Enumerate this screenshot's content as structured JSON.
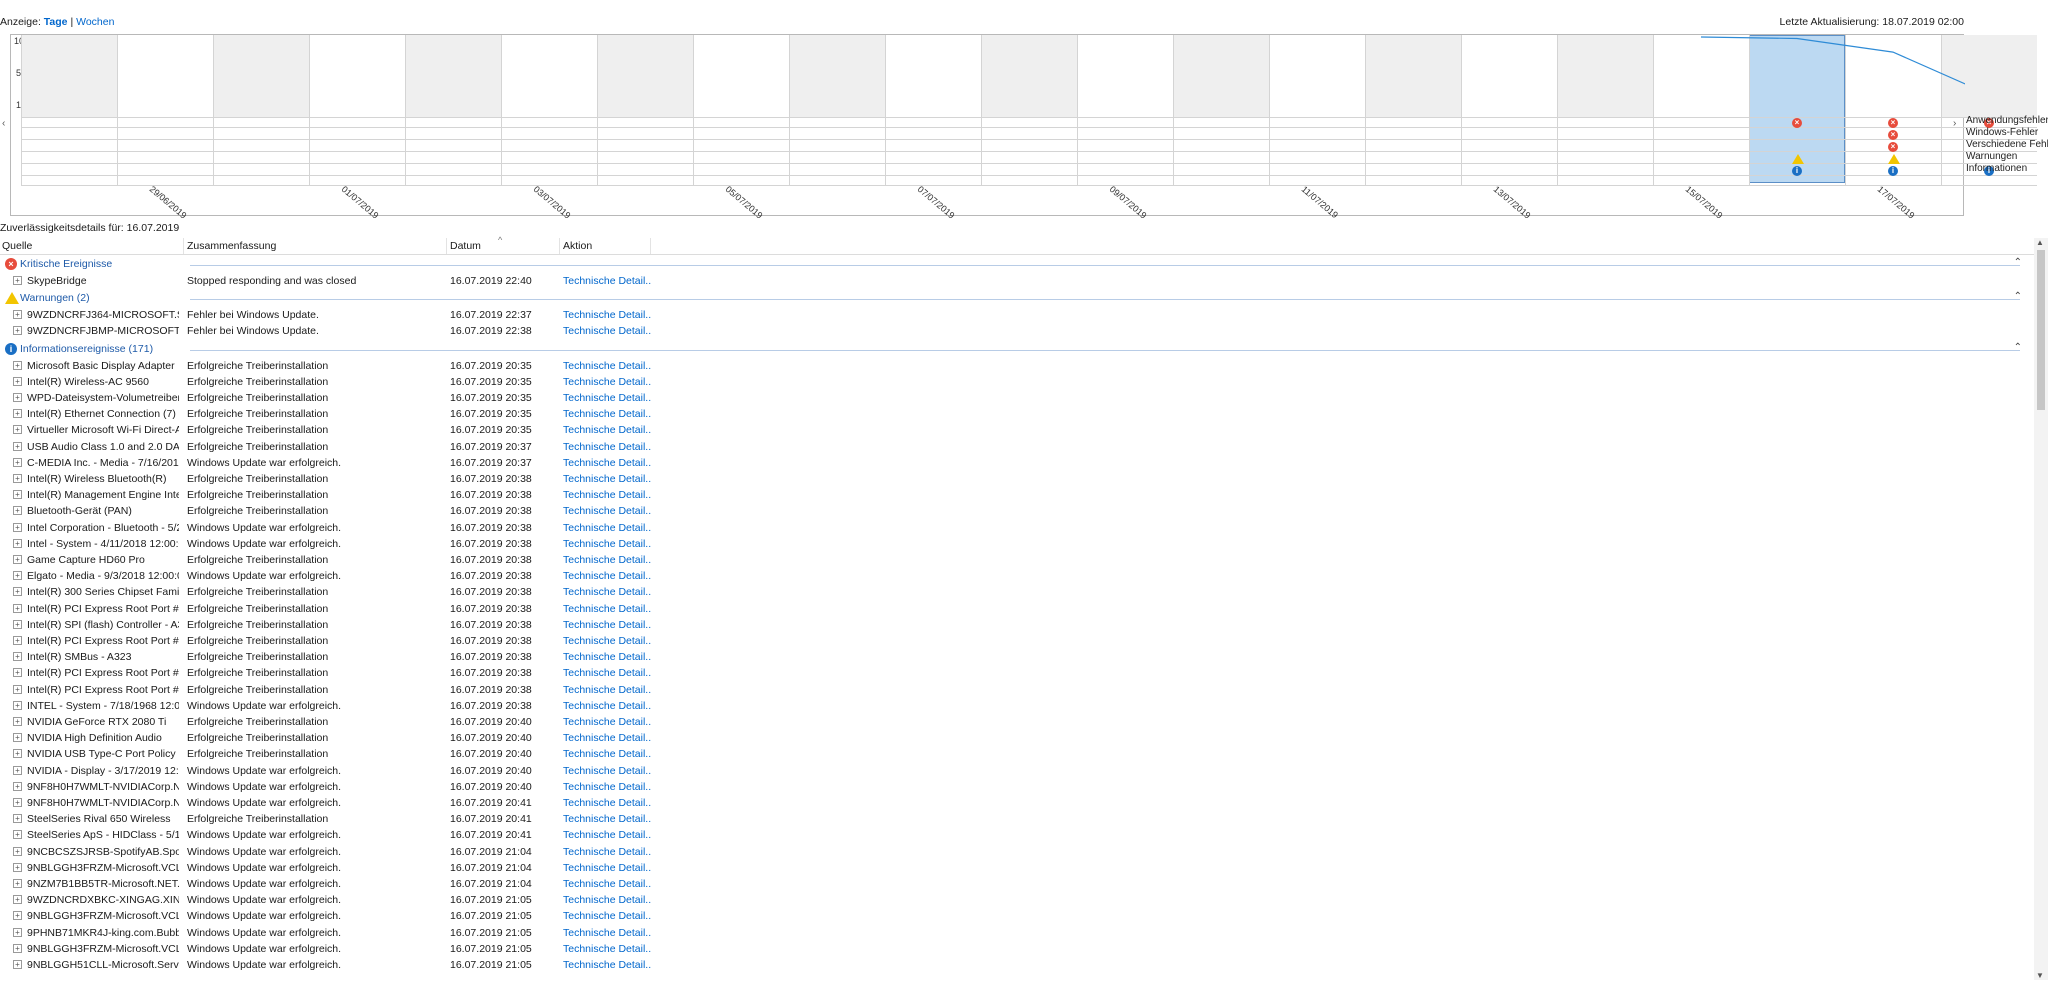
{
  "view": {
    "label": "Anzeige:",
    "days": "Tage",
    "separator": "|",
    "weeks": "Wochen"
  },
  "last_update": "Letzte Aktualisierung: 18.07.2019 02:00",
  "chart": {
    "y_ticks": [
      "10",
      "5",
      "1"
    ],
    "x_labels": [
      "29/06/2019",
      "01/07/2019",
      "03/07/2019",
      "05/07/2019",
      "07/07/2019",
      "09/07/2019",
      "11/07/2019",
      "13/07/2019",
      "15/07/2019",
      "17/07/2019"
    ],
    "row_labels": [
      "Anwendungsfehler",
      "Windows-Fehler",
      "Verschiedene Fehler",
      "Warnungen",
      "Informationen"
    ],
    "nav_left": "‹",
    "nav_right": "›"
  },
  "chart_data": {
    "type": "line",
    "title": "",
    "xlabel": "",
    "ylabel": "",
    "ylim": [
      1,
      10
    ],
    "x": [
      "28/06/2019",
      "29/06/2019",
      "30/06/2019",
      "01/07/2019",
      "02/07/2019",
      "03/07/2019",
      "04/07/2019",
      "05/07/2019",
      "06/07/2019",
      "07/07/2019",
      "08/07/2019",
      "09/07/2019",
      "10/07/2019",
      "11/07/2019",
      "12/07/2019",
      "13/07/2019",
      "14/07/2019",
      "15/07/2019",
      "16/07/2019",
      "17/07/2019",
      "18/07/2019"
    ],
    "series": [
      {
        "values": [
          null,
          null,
          null,
          null,
          null,
          null,
          null,
          null,
          null,
          null,
          null,
          null,
          null,
          null,
          null,
          null,
          null,
          10,
          9.8,
          8.0,
          2.4,
          2.2
        ]
      }
    ],
    "selected_day": "16/07/2019",
    "events": [
      {
        "day": "16/07/2019",
        "row": "Anwendungsfehler",
        "kind": "critical"
      },
      {
        "day": "16/07/2019",
        "row": "Warnungen",
        "kind": "warning"
      },
      {
        "day": "16/07/2019",
        "row": "Informationen",
        "kind": "info"
      },
      {
        "day": "17/07/2019",
        "row": "Anwendungsfehler",
        "kind": "critical"
      },
      {
        "day": "17/07/2019",
        "row": "Windows-Fehler",
        "kind": "critical"
      },
      {
        "day": "17/07/2019",
        "row": "Verschiedene Fehler",
        "kind": "critical"
      },
      {
        "day": "17/07/2019",
        "row": "Warnungen",
        "kind": "warning"
      },
      {
        "day": "17/07/2019",
        "row": "Informationen",
        "kind": "info"
      },
      {
        "day": "18/07/2019",
        "row": "Anwendungsfehler",
        "kind": "critical"
      },
      {
        "day": "18/07/2019",
        "row": "Informationen",
        "kind": "info"
      }
    ]
  },
  "details_title": "Zuverlässigkeitsdetails für: 16.07.2019",
  "table": {
    "headers": [
      "Quelle",
      "Zusammenfassung",
      "Datum",
      "Aktion"
    ],
    "sort_indicator": "^",
    "groups": [
      {
        "label": "Kritische Ereignisse",
        "icon": "critical-icon",
        "color": "#e74c3c",
        "rows": [
          [
            "SkypeBridge",
            "Stopped responding and was closed",
            "16.07.2019 22:40",
            "Technische Detail..."
          ]
        ]
      },
      {
        "label": "Warnungen (2)",
        "icon": "warning-icon",
        "color": "#f2c500",
        "rows": [
          [
            "9WZDNCRFJ364-MICROSOFT.SKY...",
            "Fehler bei Windows Update.",
            "16.07.2019 22:37",
            "Technische Detail..."
          ],
          [
            "9WZDNCRFJBMP-MICROSOFT.WI...",
            "Fehler bei Windows Update.",
            "16.07.2019 22:38",
            "Technische Detail..."
          ]
        ]
      },
      {
        "label": "Informationsereignisse (171)",
        "icon": "info-icon",
        "color": "#1a6fc4",
        "rows": [
          [
            "Microsoft Basic Display Adapter",
            "Erfolgreiche Treiberinstallation",
            "16.07.2019 20:35",
            "Technische Detail..."
          ],
          [
            "Intel(R) Wireless-AC 9560",
            "Erfolgreiche Treiberinstallation",
            "16.07.2019 20:35",
            "Technische Detail..."
          ],
          [
            "WPD-Dateisystem-Volumetreiber",
            "Erfolgreiche Treiberinstallation",
            "16.07.2019 20:35",
            "Technische Detail..."
          ],
          [
            "Intel(R) Ethernet Connection (7) I2...",
            "Erfolgreiche Treiberinstallation",
            "16.07.2019 20:35",
            "Technische Detail..."
          ],
          [
            "Virtueller Microsoft Wi-Fi Direct-A...",
            "Erfolgreiche Treiberinstallation",
            "16.07.2019 20:35",
            "Technische Detail..."
          ],
          [
            "USB Audio Class 1.0 and 2.0 DAC ...",
            "Erfolgreiche Treiberinstallation",
            "16.07.2019 20:37",
            "Technische Detail..."
          ],
          [
            "C-MEDIA Inc. - Media - 7/16/2018 ...",
            "Windows Update war erfolgreich.",
            "16.07.2019 20:37",
            "Technische Detail..."
          ],
          [
            "Intel(R) Wireless Bluetooth(R)",
            "Erfolgreiche Treiberinstallation",
            "16.07.2019 20:38",
            "Technische Detail..."
          ],
          [
            "Intel(R) Management Engine Inter...",
            "Erfolgreiche Treiberinstallation",
            "16.07.2019 20:38",
            "Technische Detail..."
          ],
          [
            "Bluetooth-Gerät (PAN)",
            "Erfolgreiche Treiberinstallation",
            "16.07.2019 20:38",
            "Technische Detail..."
          ],
          [
            "Intel Corporation - Bluetooth - 5/2...",
            "Windows Update war erfolgreich.",
            "16.07.2019 20:38",
            "Technische Detail..."
          ],
          [
            "Intel - System - 4/11/2018 12:00:0...",
            "Windows Update war erfolgreich.",
            "16.07.2019 20:38",
            "Technische Detail..."
          ],
          [
            "Game Capture HD60 Pro",
            "Erfolgreiche Treiberinstallation",
            "16.07.2019 20:38",
            "Technische Detail..."
          ],
          [
            "Elgato - Media - 9/3/2018 12:00:00...",
            "Windows Update war erfolgreich.",
            "16.07.2019 20:38",
            "Technische Detail..."
          ],
          [
            "Intel(R) 300 Series Chipset Family ...",
            "Erfolgreiche Treiberinstallation",
            "16.07.2019 20:38",
            "Technische Detail..."
          ],
          [
            "Intel(R) PCI Express Root Port #17 ...",
            "Erfolgreiche Treiberinstallation",
            "16.07.2019 20:38",
            "Technische Detail..."
          ],
          [
            "Intel(R) SPI (flash) Controller - A324",
            "Erfolgreiche Treiberinstallation",
            "16.07.2019 20:38",
            "Technische Detail..."
          ],
          [
            "Intel(R) PCI Express Root Port #8 - ...",
            "Erfolgreiche Treiberinstallation",
            "16.07.2019 20:38",
            "Technische Detail..."
          ],
          [
            "Intel(R) SMBus - A323",
            "Erfolgreiche Treiberinstallation",
            "16.07.2019 20:38",
            "Technische Detail..."
          ],
          [
            "Intel(R) PCI Express Root Port #9 - ...",
            "Erfolgreiche Treiberinstallation",
            "16.07.2019 20:38",
            "Technische Detail..."
          ],
          [
            "Intel(R) PCI Express Root Port #1 - ...",
            "Erfolgreiche Treiberinstallation",
            "16.07.2019 20:38",
            "Technische Detail..."
          ],
          [
            "INTEL - System - 7/18/1968 12:00:0...",
            "Windows Update war erfolgreich.",
            "16.07.2019 20:38",
            "Technische Detail..."
          ],
          [
            "NVIDIA GeForce RTX 2080 Ti",
            "Erfolgreiche Treiberinstallation",
            "16.07.2019 20:40",
            "Technische Detail..."
          ],
          [
            "NVIDIA High Definition Audio",
            "Erfolgreiche Treiberinstallation",
            "16.07.2019 20:40",
            "Technische Detail..."
          ],
          [
            "NVIDIA USB Type-C Port Policy Co...",
            "Erfolgreiche Treiberinstallation",
            "16.07.2019 20:40",
            "Technische Detail..."
          ],
          [
            "NVIDIA - Display - 3/17/2019 12:00...",
            "Windows Update war erfolgreich.",
            "16.07.2019 20:40",
            "Technische Detail..."
          ],
          [
            "9NF8H0H7WMLT-NVIDIACorp.NVI...",
            "Windows Update war erfolgreich.",
            "16.07.2019 20:40",
            "Technische Detail..."
          ],
          [
            "9NF8H0H7WMLT-NVIDIACorp.NVI...",
            "Windows Update war erfolgreich.",
            "16.07.2019 20:41",
            "Technische Detail..."
          ],
          [
            "SteelSeries Rival 650 Wireless",
            "Erfolgreiche Treiberinstallation",
            "16.07.2019 20:41",
            "Technische Detail..."
          ],
          [
            "SteelSeries ApS - HIDClass - 5/14/...",
            "Windows Update war erfolgreich.",
            "16.07.2019 20:41",
            "Technische Detail..."
          ],
          [
            "9NCBCSZSJRSB-SpotifyAB.Spotify...",
            "Windows Update war erfolgreich.",
            "16.07.2019 21:04",
            "Technische Detail..."
          ],
          [
            "9NBLGGH3FRZM-Microsoft.VCLib...",
            "Windows Update war erfolgreich.",
            "16.07.2019 21:04",
            "Technische Detail..."
          ],
          [
            "9NZM7B1BB5TR-Microsoft.NET.N...",
            "Windows Update war erfolgreich.",
            "16.07.2019 21:04",
            "Technische Detail..."
          ],
          [
            "9WZDNCRDXBKC-XINGAG.XING",
            "Windows Update war erfolgreich.",
            "16.07.2019 21:05",
            "Technische Detail..."
          ],
          [
            "9NBLGGH3FRZM-Microsoft.VCLib...",
            "Windows Update war erfolgreich.",
            "16.07.2019 21:05",
            "Technische Detail..."
          ],
          [
            "9PHNB71MKR4J-king.com.Bubble...",
            "Windows Update war erfolgreich.",
            "16.07.2019 21:05",
            "Technische Detail..."
          ],
          [
            "9NBLGGH3FRZM-Microsoft.VCLib...",
            "Windows Update war erfolgreich.",
            "16.07.2019 21:05",
            "Technische Detail..."
          ],
          [
            "9NBLGGH51CLL-Microsoft.Service...",
            "Windows Update war erfolgreich.",
            "16.07.2019 21:05",
            "Technische Detail..."
          ]
        ]
      }
    ]
  }
}
